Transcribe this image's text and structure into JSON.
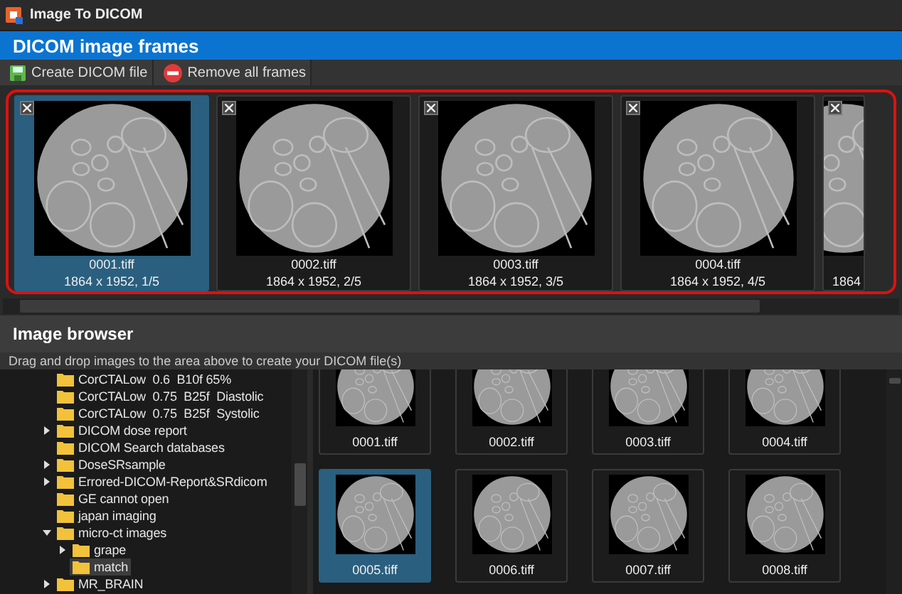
{
  "window": {
    "title": "Image To DICOM"
  },
  "frames_panel": {
    "title": "DICOM image frames",
    "toolbar": [
      {
        "label": "Create DICOM file",
        "kind": "save"
      },
      {
        "label": "Remove all frames",
        "kind": "remove"
      }
    ],
    "frames": [
      {
        "filename": "0001.tiff",
        "info": "1864 x 1952, 1/5",
        "selected": true
      },
      {
        "filename": "0002.tiff",
        "info": "1864 x 1952, 2/5",
        "selected": false
      },
      {
        "filename": "0003.tiff",
        "info": "1864 x 1952, 3/5",
        "selected": false
      },
      {
        "filename": "0004.tiff",
        "info": "1864 x 1952, 4/5",
        "selected": false
      },
      {
        "info": "1864",
        "selected": false
      }
    ]
  },
  "browser": {
    "title": "Image browser",
    "hint": "Drag and drop images to the area above to create your DICOM file(s)",
    "tree": [
      {
        "label": "CorCTALow  0.6  B10f 65%",
        "selected": false
      },
      {
        "label": "CorCTALow  0.75  B25f  Diastolic",
        "selected": false
      },
      {
        "label": "CorCTALow  0.75  B25f  Systolic",
        "selected": false
      },
      {
        "label": "DICOM dose report",
        "expanded": false,
        "selected": false
      },
      {
        "label": "DICOM Search databases",
        "selected": false
      },
      {
        "label": "DoseSRsample",
        "expanded": false,
        "selected": false
      },
      {
        "label": "Errored-DICOM-Report&SRdicom",
        "expanded": false,
        "selected": false
      },
      {
        "label": "GE cannot open",
        "selected": false
      },
      {
        "label": "japan imaging",
        "selected": false
      },
      {
        "label": "micro-ct images",
        "expanded": true,
        "selected": false,
        "children": [
          {
            "label": "grape",
            "expanded": false,
            "selected": false
          },
          {
            "label": "match",
            "selected": true
          }
        ]
      },
      {
        "label": "MR_BRAIN",
        "expanded": false,
        "selected": false
      }
    ],
    "thumbnails": [
      {
        "filename": "0001.tiff",
        "selected": false
      },
      {
        "filename": "0002.tiff",
        "selected": false
      },
      {
        "filename": "0003.tiff",
        "selected": false
      },
      {
        "filename": "0004.tiff",
        "selected": false
      },
      {
        "filename": "0005.tiff",
        "selected": true
      },
      {
        "filename": "0006.tiff",
        "selected": false
      },
      {
        "filename": "0007.tiff",
        "selected": false
      },
      {
        "filename": "0008.tiff",
        "selected": false
      }
    ]
  }
}
